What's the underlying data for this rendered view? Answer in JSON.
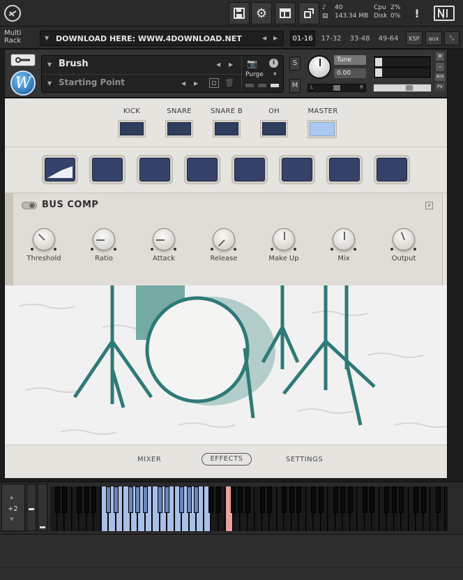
{
  "toolbar": {
    "stats": {
      "voices": "40",
      "memory": "143.34 MB",
      "cpu_label": "Cpu",
      "cpu_value": "2%",
      "disk_label": "Disk",
      "disk_value": "0%"
    },
    "alert_label": "!"
  },
  "rack": {
    "label": "Multi Rack",
    "preset_text": "DOWNLOAD HERE: WWW.4DOWNLOAD.NET",
    "page_tabs": [
      "01-16",
      "17-32",
      "33-48",
      "49-64"
    ],
    "active_page": "01-16",
    "ksp_label": "KSP",
    "aux_label": "aux"
  },
  "instrument": {
    "name": "Brush",
    "snapshot": "Starting Point",
    "purge_label": "Purge",
    "solo_label": "S",
    "mute_label": "M",
    "tune_label": "Tune",
    "tune_value": "0.00",
    "pan_left": "L",
    "pan_right": "R",
    "side_aux": "AUX",
    "side_pv": "PV"
  },
  "mixer_channels": {
    "items": [
      "KICK",
      "SNARE",
      "SNARE B",
      "OH",
      "MASTER"
    ],
    "selected": "MASTER"
  },
  "fx_slots": {
    "count": 8,
    "active_index": 0
  },
  "effect": {
    "title": "BUS COMP",
    "knobs": [
      "Threshold",
      "Ratio",
      "Attack",
      "Release",
      "Make Up",
      "Mix",
      "Output"
    ],
    "knob_angles": [
      -45,
      -90,
      -90,
      -135,
      0,
      0,
      -20
    ]
  },
  "bottom_tabs": {
    "items": [
      "MIXER",
      "EFFECTS",
      "SETTINGS"
    ],
    "active": "EFFECTS"
  },
  "keyboard": {
    "octave_label": "+2",
    "minus_label": "–"
  },
  "colors": {
    "accent_blue": "#2f3d5e",
    "highlight": "#a9c7ef",
    "drum_teal": "#2e7a78"
  }
}
